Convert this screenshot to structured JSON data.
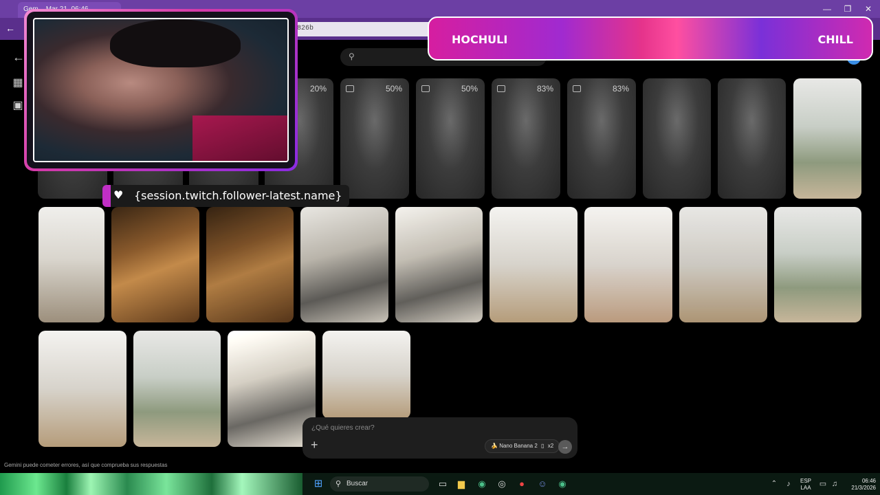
{
  "browser": {
    "tab_title": "Gem... Mar 21, 06:46",
    "address": "826b"
  },
  "app": {
    "prompt": {
      "placeholder": "¿Qué quieres crear?",
      "model_label": "Nano Banana 2",
      "count_label": "x2"
    },
    "disclaimer": "Gemini puede cometer errores, así que comprueba sus respuestas",
    "placeholders": [
      {
        "progress_label": "20%"
      },
      {
        "progress_label": "50%"
      },
      {
        "progress_label": "50%"
      },
      {
        "progress_label": "83%"
      },
      {
        "progress_label": "83%"
      }
    ]
  },
  "overlay": {
    "banner_left": "HOCHULI",
    "banner_right": "CHILL",
    "follower_text": "{session.twitch.follower-latest.name}"
  },
  "taskbar": {
    "search_label": "Buscar",
    "lang_top": "ESP",
    "lang_bottom": "LAA",
    "time": "06:46",
    "date": "21/3/2026"
  },
  "colors": {
    "accent_pink": "#d61ea0",
    "accent_purple": "#8a2be2",
    "titlebar": "#6c3fa4"
  }
}
